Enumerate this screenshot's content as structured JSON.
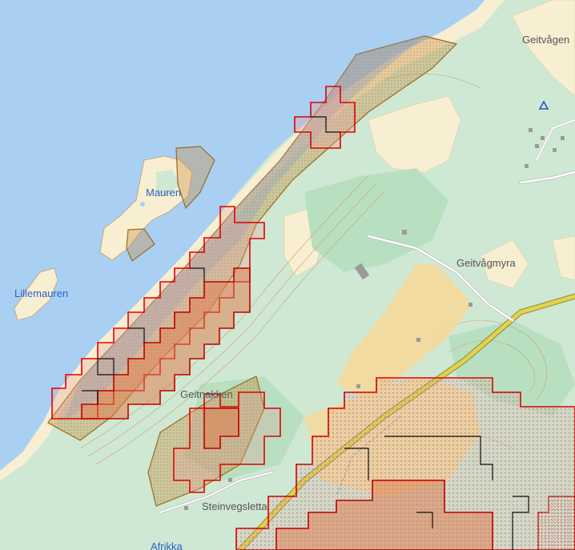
{
  "map": {
    "labels": {
      "geitvagen": "Geitvågen",
      "mauren": "Mauren",
      "lillemauren": "Lillemauren",
      "geitvagmyra": "Geitvågmyra",
      "geitnakken": "Geitnakken",
      "steinvegsletta": "Steinvegsletta",
      "afrikka": "Afrikka"
    },
    "colors": {
      "water": "#a9cff2",
      "land": "#cfe8d3",
      "forest": "#b8e0c0",
      "sand": "#f8efd2",
      "hazard_fill": "#c88a3a",
      "grid_red": "#e00000",
      "grid_black": "#000000",
      "road": "#e4d24b",
      "water_label": "#2a63c8",
      "place_label": "#555555"
    },
    "icons": [
      "triangle-marker-icon"
    ]
  }
}
